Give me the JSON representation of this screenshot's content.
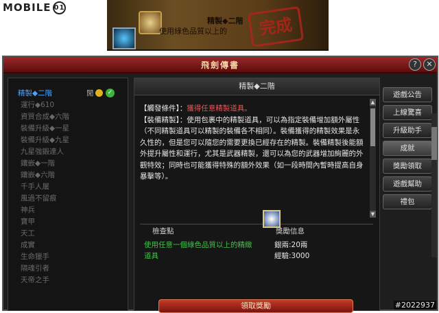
{
  "watermark": {
    "brand": "MOBILE",
    "suffix": "01"
  },
  "banner": {
    "title": "精製◆二階",
    "subtitle": "使用綠色品質以上的",
    "stamp": "完成"
  },
  "window": {
    "title": "飛劍傳書",
    "help_label": "?",
    "close_label": "✕"
  },
  "quest_list": [
    {
      "label": "精製◆二階",
      "tag": "閒",
      "selected": true
    },
    {
      "label": "運行◆610"
    },
    {
      "label": "資質合成◆六階"
    },
    {
      "label": "裝備升級◆一星"
    },
    {
      "label": "裝備升級◆九星"
    },
    {
      "label": "九星強鍛達人"
    },
    {
      "label": "鑲嵌◆一階"
    },
    {
      "label": "鑲嵌◆六階"
    },
    {
      "label": "千手人屠"
    },
    {
      "label": "風過不留痕"
    },
    {
      "label": "神兵"
    },
    {
      "label": "寶甲"
    },
    {
      "label": "天工"
    },
    {
      "label": "成實"
    },
    {
      "label": "生命獵手"
    },
    {
      "label": "隔魂引者"
    },
    {
      "label": "天帝之手"
    }
  ],
  "detail": {
    "header": "精製◆二階",
    "trigger_label": "【觸發條件】：",
    "trigger_value": "獲得任意精製道具。",
    "equip_label": "【裝備精製】：",
    "equip_text": "使用包裹中的精製道具，可以為指定裝備增加額外屬性（不同精製道具可以精製的裝備各不相同）。裝備獲得的精製效果是永久性的，但是您可以隨您的需要更換已經存在的精製。裝備精製後能額外提升屬性和運行，尤其是武器精製，還可以為您的武器增加絢麗的外觀特效；同時也可能獲得特殊的額外效果（如一段時間內暫時提高自身暴擊等）。",
    "check_header": "檢查點",
    "reward_header": "獎勵信息",
    "condition": "使用任意一個綠色品質以上的精緻道具",
    "reward_silver": "銀兩:20兩",
    "reward_exp": "經驗:3000",
    "claim_button": "領取獎勵"
  },
  "side_menu": [
    {
      "label": "遊戲公告"
    },
    {
      "label": "上線驚喜"
    },
    {
      "label": "升級助手"
    },
    {
      "label": "成就",
      "active": true
    },
    {
      "label": "獎勵領取"
    },
    {
      "label": "遊戲幫助"
    },
    {
      "label": "禮包"
    }
  ],
  "image_number": "#2022937"
}
